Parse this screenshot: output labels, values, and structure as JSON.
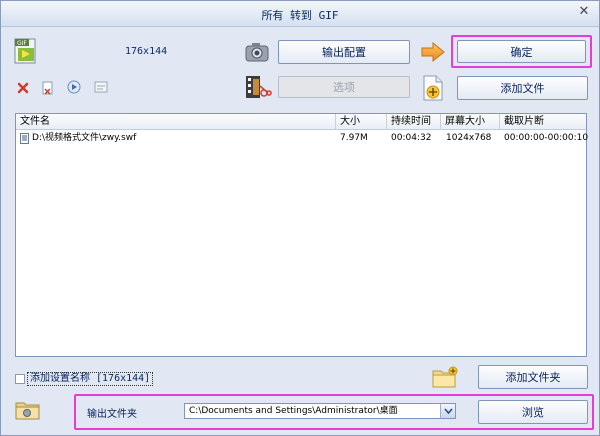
{
  "window": {
    "title": "所有 转到 GIF",
    "close_glyph": "✕"
  },
  "toolbar": {
    "size_label": "176x144",
    "output_config_label": "输出配置",
    "options_label": "选项",
    "confirm_label": "确定",
    "add_file_label": "添加文件"
  },
  "file_table": {
    "columns": [
      "文件名",
      "大小",
      "持续时间",
      "屏幕大小",
      "截取片断"
    ],
    "rows": [
      {
        "name": "D:\\视频格式文件\\zwy.swf",
        "size": "7.97M",
        "duration": "00:04:32",
        "screen": "1024x768",
        "clip": "00:00:00-00:00:10"
      }
    ]
  },
  "bottom": {
    "add_setting_label": "添加设置名称 [176x144]",
    "add_folder_label": "添加文件夹",
    "output_folder_label": "输出文件夹",
    "output_path": "C:\\Documents and Settings\\Administrator\\桌面",
    "browse_label": "浏览"
  },
  "colors": {
    "highlight": "#e53bd7",
    "accent_arrow": "#f59a23",
    "delete_red": "#d23b2b"
  }
}
